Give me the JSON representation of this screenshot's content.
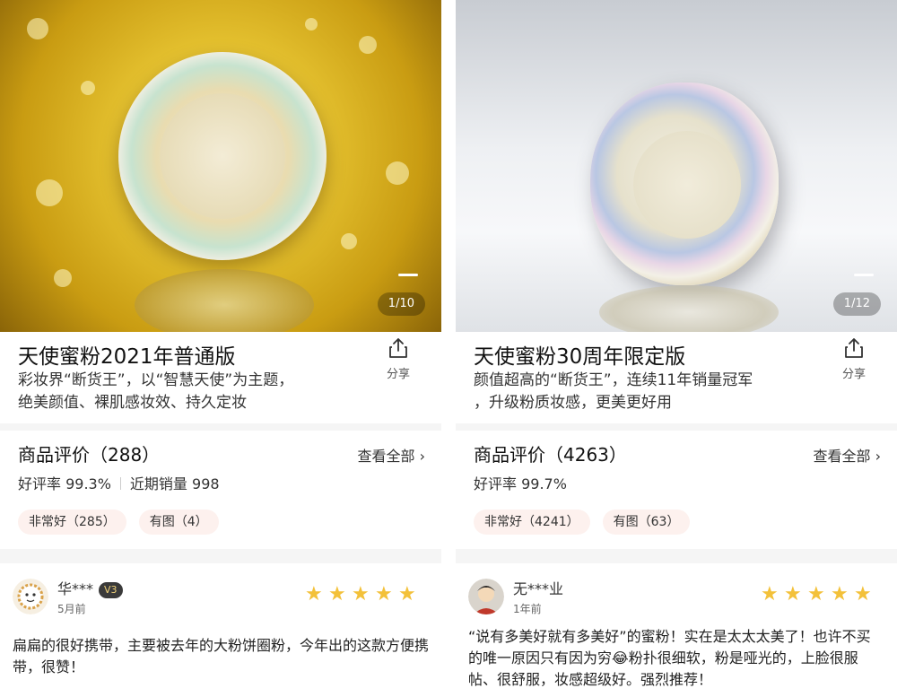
{
  "left": {
    "counter": "1/10",
    "title": "天使蜜粉2021年普通版",
    "share_label": "分享",
    "desc_line1": "彩妆界“断货王”，以“智慧天使”为主题，",
    "desc_line2": "绝美颜值、裸肌感妆效、持久定妆",
    "reviews_title": "商品评价（288）",
    "view_all": "查看全部 ›",
    "rating_text": "好评率 99.3%",
    "sales_text": "近期销量 998",
    "tags": [
      "非常好（285）",
      "有图（4）"
    ],
    "review": {
      "user": "华***",
      "level": "V3",
      "date": "5月前",
      "stars": 5,
      "text": "扁扁的很好携带，主要被去年的大粉饼圈粉，今年出的这款方便携带，很赞！"
    }
  },
  "right": {
    "counter": "1/12",
    "title": "天使蜜粉30周年限定版",
    "share_label": "分享",
    "desc_line1": "颜值超高的“断货王”，连续11年销量冠军",
    "desc_line2": "，升级粉质妆感，更美更好用",
    "reviews_title": "商品评价（4263）",
    "view_all": "查看全部 ›",
    "rating_text": "好评率 99.7%",
    "tags": [
      "非常好（4241）",
      "有图（63）"
    ],
    "review": {
      "user": "无***业",
      "date": "1年前",
      "stars": 5,
      "text": "“说有多美好就有多美好”的蜜粉！实在是太太太美了！也许不买的唯一原因只有因为穷😂粉扑很细软，粉是哑光的，上脸很服帖、很舒服，妆感超级好。强烈推荐！"
    }
  },
  "colors": {
    "star": "#f3c13a",
    "tag_bg": "#fdf1ee"
  },
  "icons": [
    "share-icon",
    "star-icon",
    "chevron-right-icon"
  ]
}
